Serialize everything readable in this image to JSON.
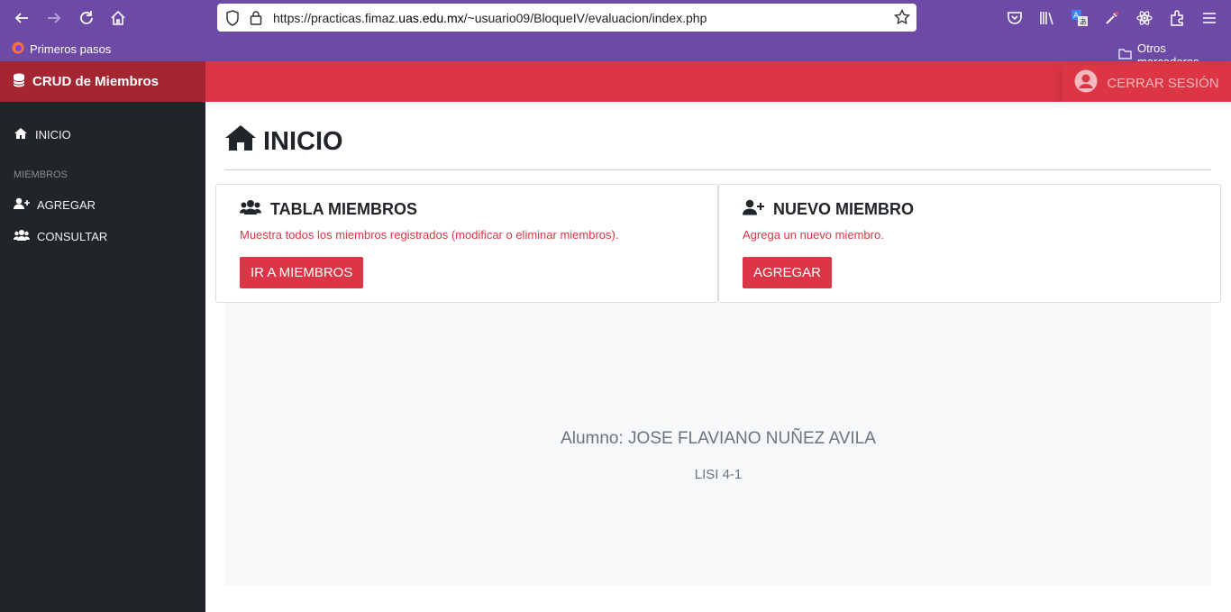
{
  "browser": {
    "url_prefix": "https://practicas.fimaz.",
    "url_domain": "uas.edu.mx",
    "url_suffix": "/~usuario09/BloqueIV/evaluacion/index.php",
    "bookmark_left": "Primeros pasos",
    "bookmark_right": "Otros marcadores"
  },
  "app": {
    "brand": "CRUD de Miembros",
    "logout": "CERRAR SESIÓN"
  },
  "sidebar": {
    "home": "INICIO",
    "section": "MIEMBROS",
    "add": "AGREGAR",
    "list": "CONSULTAR"
  },
  "main": {
    "title": "INICIO",
    "cards": [
      {
        "title": "TABLA MIEMBROS",
        "text": "Muestra todos los miembros registrados (modificar o eliminar miembros).",
        "button": "IR A MIEMBROS"
      },
      {
        "title": "NUEVO MIEMBRO",
        "text": "Agrega un nuevo miembro.",
        "button": "AGREGAR"
      }
    ],
    "student": "Alumno: JOSE FLAVIANO NUÑEZ AVILA",
    "group": "LISI 4-1"
  },
  "colors": {
    "accent": "#dc3545",
    "brand_dark": "#a52633",
    "sidebar": "#212529",
    "browser": "#6d4aa5"
  }
}
